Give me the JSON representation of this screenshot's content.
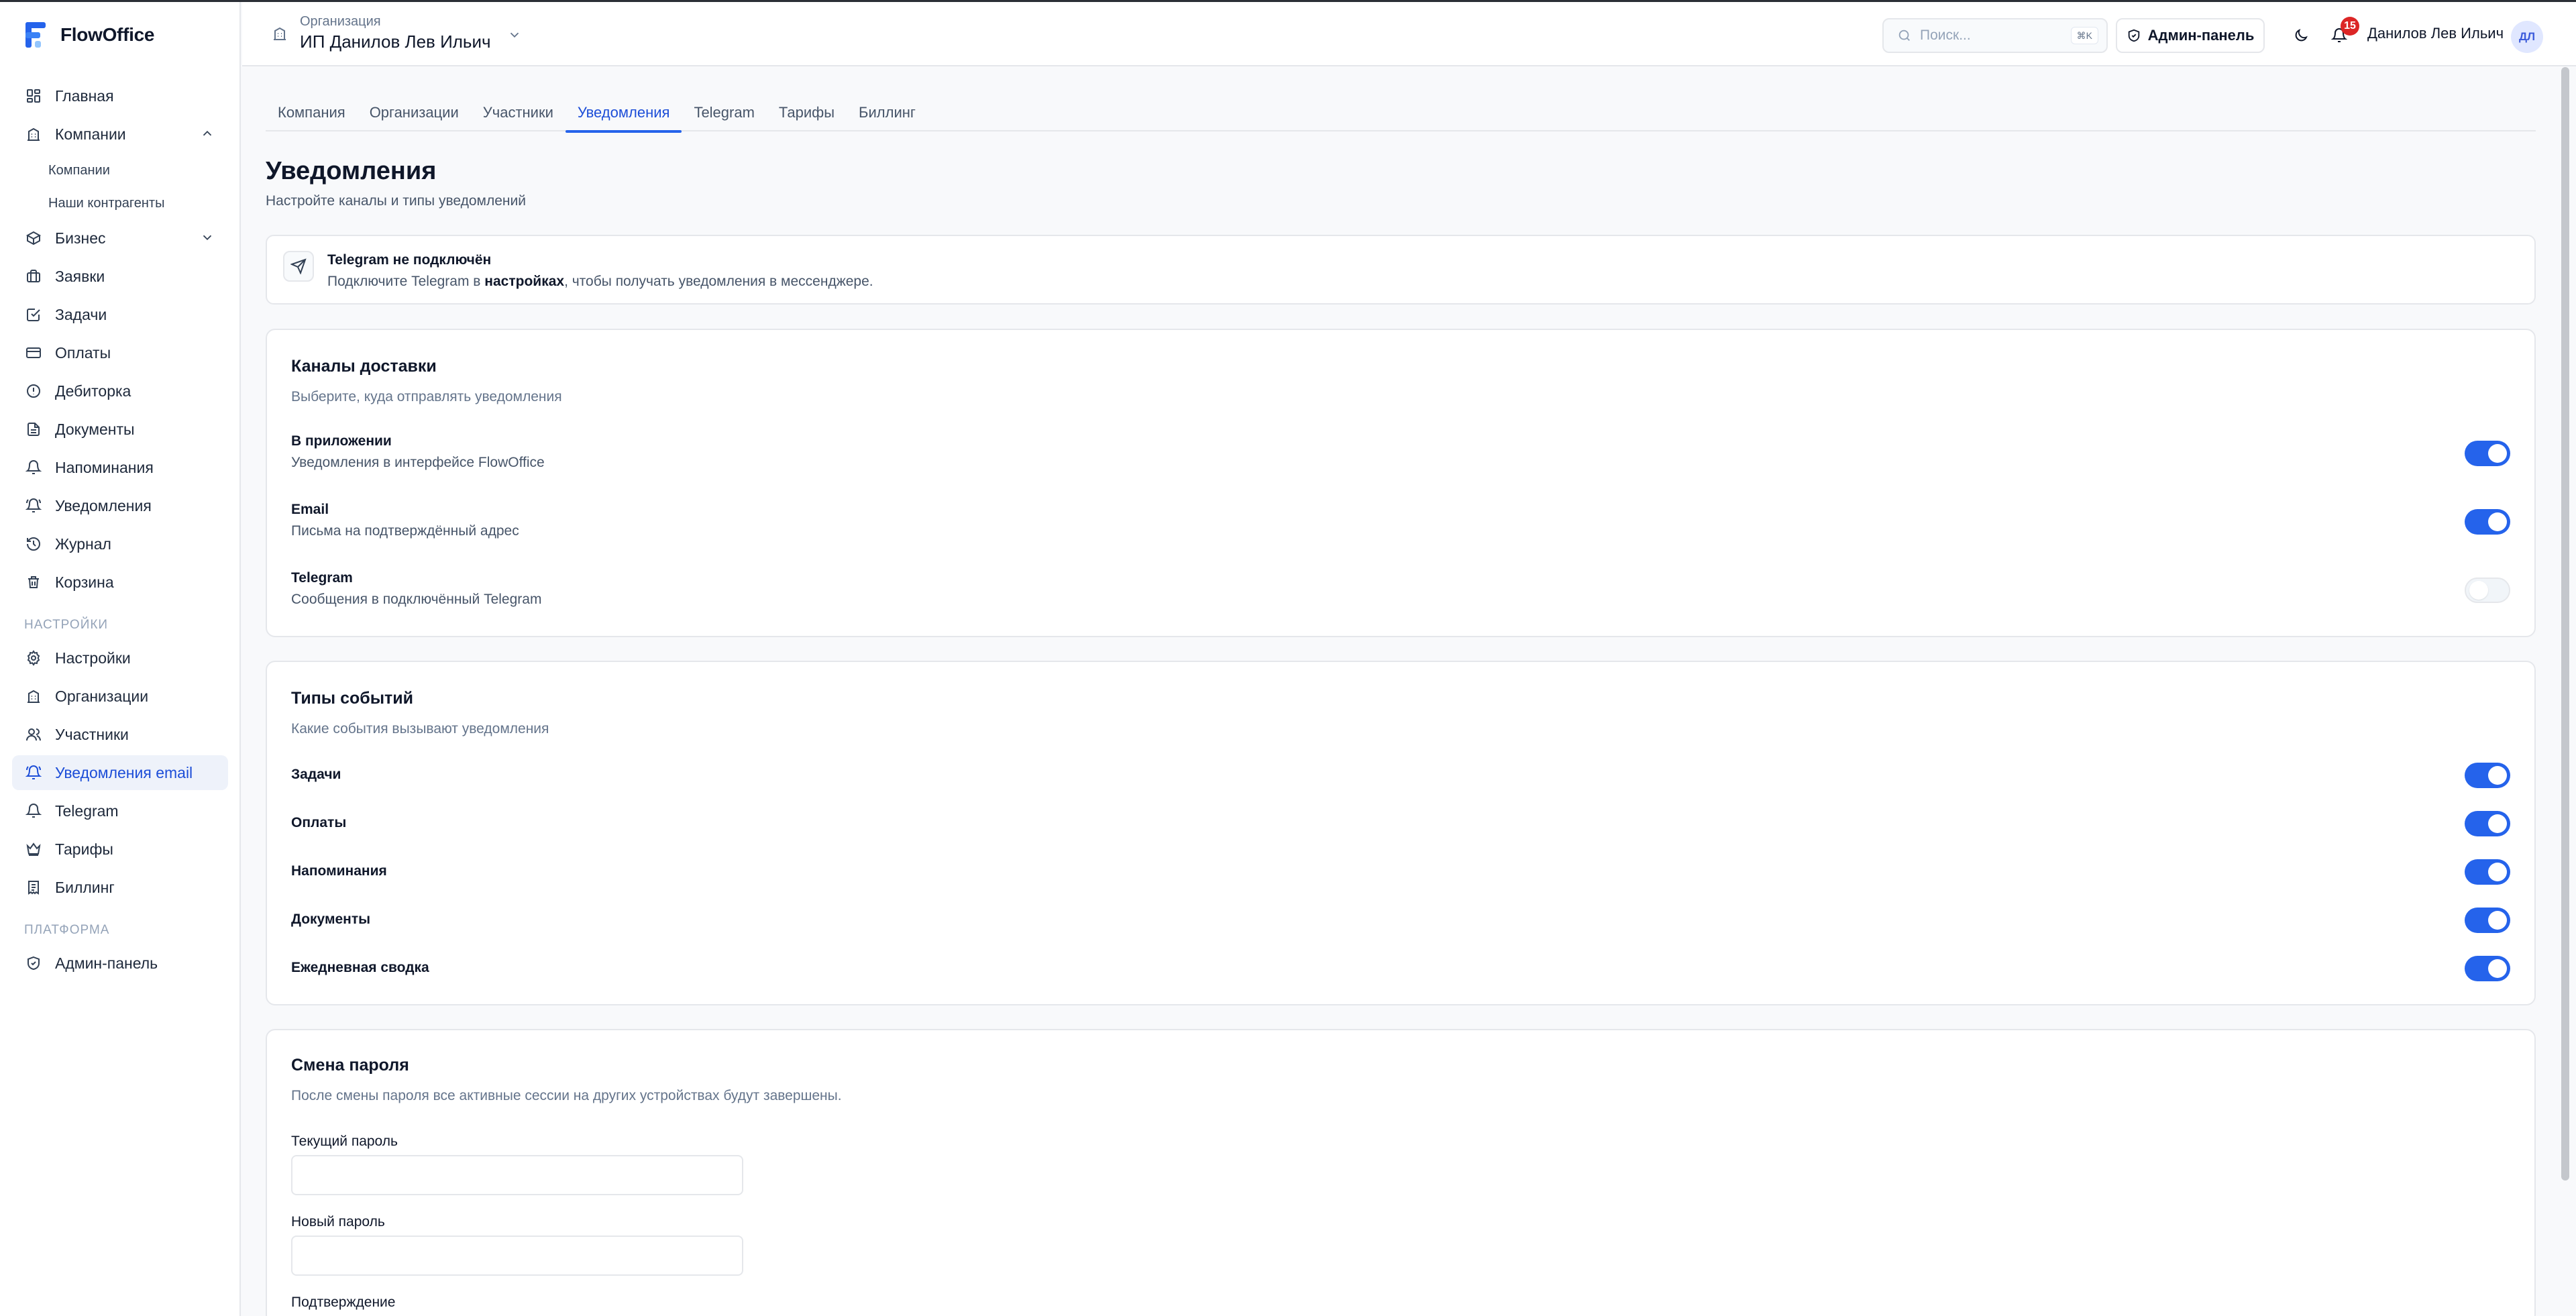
{
  "app": {
    "name": "FlowOffice"
  },
  "colors": {
    "accent": "#2563eb",
    "badge": "#dc2626",
    "sidebar_active_bg": "#eef2fa"
  },
  "sidebar": {
    "items": [
      {
        "label": "Главная",
        "icon": "dashboard-icon"
      },
      {
        "label": "Компании",
        "icon": "building-icon",
        "expanded": true
      },
      {
        "label": "Компании",
        "icon": "",
        "sub": true
      },
      {
        "label": "Наши контрагенты",
        "icon": "",
        "sub": true
      },
      {
        "label": "Бизнес",
        "icon": "box-icon",
        "expandable": true
      },
      {
        "label": "Заявки",
        "icon": "briefcase-icon"
      },
      {
        "label": "Задачи",
        "icon": "check-square-icon"
      },
      {
        "label": "Оплаты",
        "icon": "credit-card-icon"
      },
      {
        "label": "Дебиторка",
        "icon": "alert-circle-icon"
      },
      {
        "label": "Документы",
        "icon": "file-text-icon"
      },
      {
        "label": "Напоминания",
        "icon": "bell-icon"
      },
      {
        "label": "Уведомления",
        "icon": "bell-ring-icon"
      },
      {
        "label": "Журнал",
        "icon": "history-icon"
      },
      {
        "label": "Корзина",
        "icon": "trash-icon"
      }
    ],
    "settings_section": "НАСТРОЙКИ",
    "settings_items": [
      {
        "label": "Настройки",
        "icon": "gear-icon"
      },
      {
        "label": "Организации",
        "icon": "building-icon"
      },
      {
        "label": "Участники",
        "icon": "users-icon"
      },
      {
        "label": "Уведомления email",
        "icon": "bell-ring-icon",
        "active": true
      },
      {
        "label": "Telegram",
        "icon": "bell-icon"
      },
      {
        "label": "Тарифы",
        "icon": "crown-icon"
      },
      {
        "label": "Биллинг",
        "icon": "receipt-icon"
      }
    ],
    "platform_section": "ПЛАТФОРМА",
    "platform_items": [
      {
        "label": "Админ-панель",
        "icon": "shield-icon"
      }
    ]
  },
  "header": {
    "org_caption": "Организация",
    "org_name": "ИП Данилов Лев Ильич",
    "search_placeholder": "Поиск...",
    "search_shortcut": "⌘K",
    "admin_label": "Админ-панель",
    "notifications_count": "15",
    "user_name": "Данилов Лев Ильич",
    "user_initials": "ДЛ"
  },
  "tabs": [
    {
      "label": "Компания"
    },
    {
      "label": "Организации"
    },
    {
      "label": "Участники"
    },
    {
      "label": "Уведомления",
      "active": true
    },
    {
      "label": "Telegram"
    },
    {
      "label": "Тарифы"
    },
    {
      "label": "Биллинг"
    }
  ],
  "page": {
    "title": "Уведомления",
    "subtitle": "Настройте каналы и типы уведомлений"
  },
  "alert": {
    "title": "Telegram не подключён",
    "text_before": "Подключите Telegram в ",
    "link": "настройках",
    "text_after": ", чтобы получать уведомления в мессенджере."
  },
  "channels": {
    "title": "Каналы доставки",
    "subtitle": "Выберите, куда отправлять уведомления",
    "items": [
      {
        "title": "В приложении",
        "desc": "Уведомления в интерфейсе FlowOffice",
        "enabled": true
      },
      {
        "title": "Email",
        "desc": "Письма на подтверждённый адрес",
        "enabled": true
      },
      {
        "title": "Telegram",
        "desc": "Сообщения в подключённый Telegram",
        "enabled": false
      }
    ]
  },
  "events": {
    "title": "Типы событий",
    "subtitle": "Какие события вызывают уведомления",
    "items": [
      {
        "title": "Задачи",
        "enabled": true
      },
      {
        "title": "Оплаты",
        "enabled": true
      },
      {
        "title": "Напоминания",
        "enabled": true
      },
      {
        "title": "Документы",
        "enabled": true
      },
      {
        "title": "Ежедневная сводка",
        "enabled": true
      }
    ]
  },
  "password": {
    "title": "Смена пароля",
    "subtitle": "После смены пароля все активные сессии на других устройствах будут завершены.",
    "current_label": "Текущий пароль",
    "current_value": "",
    "new_label": "Новый пароль",
    "new_value": "",
    "confirm_label": "Подтверждение"
  }
}
